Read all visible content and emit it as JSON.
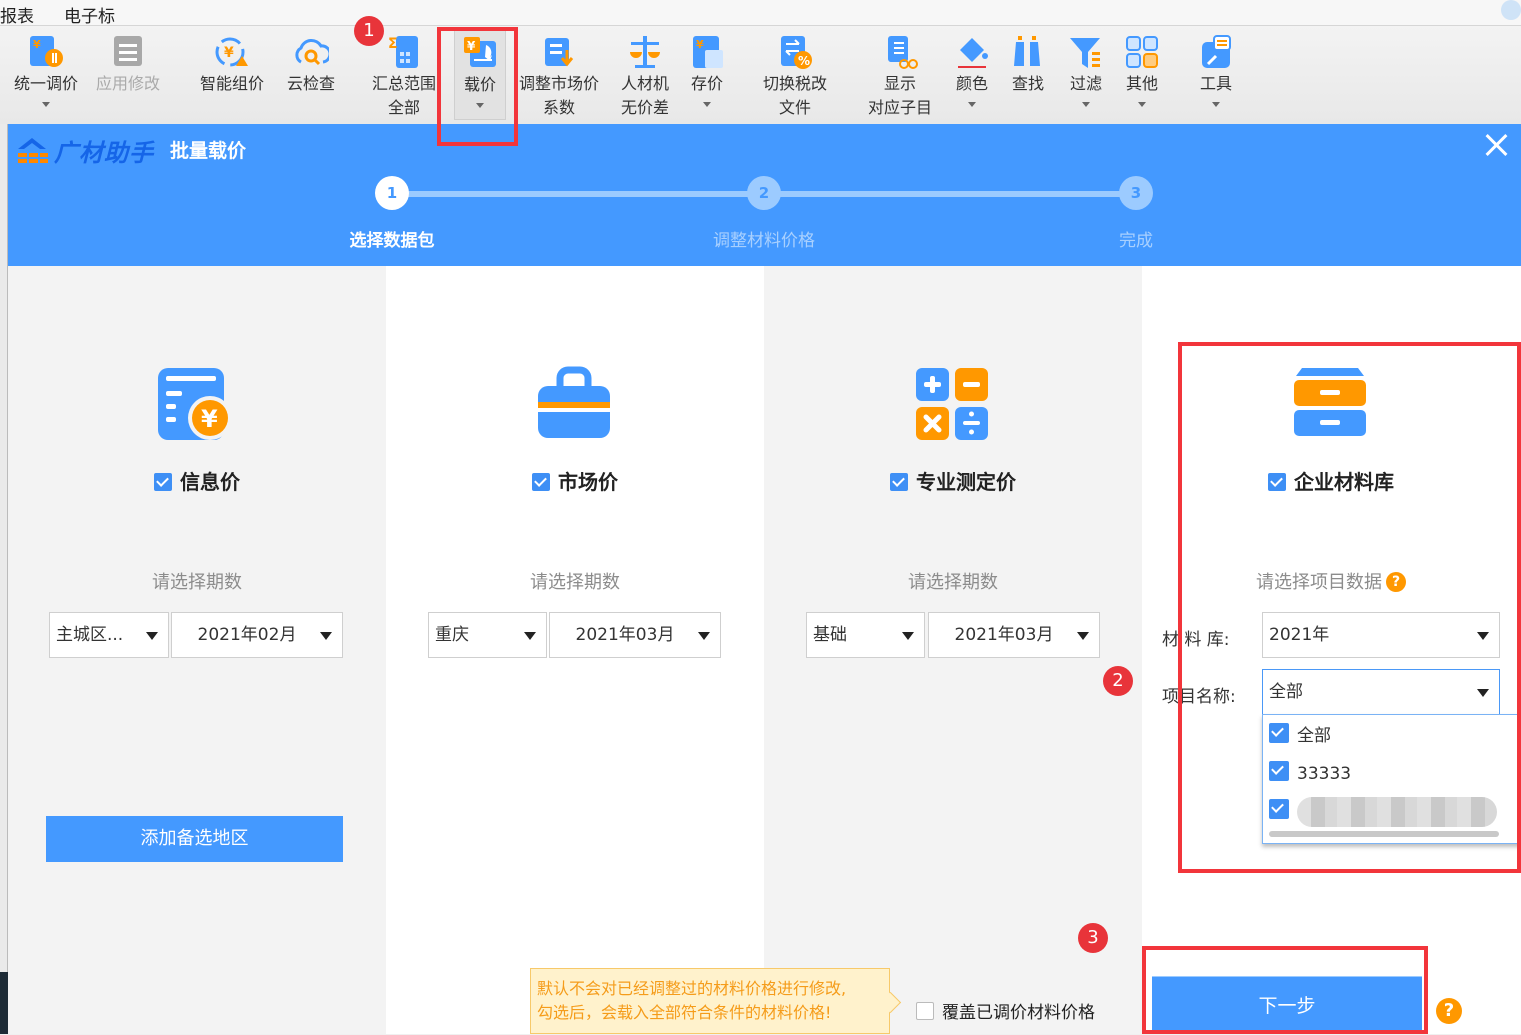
{
  "menubar": {
    "items": [
      "报表",
      "电子标"
    ]
  },
  "ribbon": {
    "buttons": [
      {
        "label": "统一调价",
        "label2": "",
        "caret": true,
        "disabled": false
      },
      {
        "label": "应用修改",
        "label2": "",
        "caret": false,
        "disabled": true
      },
      {
        "label": "智能组价",
        "label2": "",
        "caret": false,
        "disabled": false
      },
      {
        "label": "云检查",
        "label2": "",
        "caret": false,
        "disabled": false
      },
      {
        "label": "汇总范围",
        "label2": "全部",
        "caret": false,
        "disabled": false
      },
      {
        "label": "载价",
        "label2": "",
        "caret": true,
        "disabled": false,
        "active": true
      },
      {
        "label": "调整市场价",
        "label2": "系数",
        "caret": false,
        "disabled": false
      },
      {
        "label": "人材机",
        "label2": "无价差",
        "caret": false,
        "disabled": false
      },
      {
        "label": "存价",
        "label2": "",
        "caret": true,
        "disabled": false
      },
      {
        "label": "切换税改",
        "label2": "文件",
        "caret": false,
        "disabled": false
      },
      {
        "label": "显示",
        "label2": "对应子目",
        "caret": false,
        "disabled": false
      },
      {
        "label": "颜色",
        "label2": "",
        "caret": true,
        "disabled": false
      },
      {
        "label": "查找",
        "label2": "",
        "caret": false,
        "disabled": false
      },
      {
        "label": "过滤",
        "label2": "",
        "caret": true,
        "disabled": false
      },
      {
        "label": "其他",
        "label2": "",
        "caret": true,
        "disabled": false
      },
      {
        "label": "工具",
        "label2": "",
        "caret": true,
        "disabled": false
      }
    ]
  },
  "annotations": {
    "badge1": "1",
    "badge2": "2",
    "badge3": "3"
  },
  "dialog": {
    "brand": "广材助手",
    "title": "批量载价",
    "steps": [
      {
        "num": "1",
        "label": "选择数据包",
        "active": true
      },
      {
        "num": "2",
        "label": "调整材料价格",
        "active": false
      },
      {
        "num": "3",
        "label": "完成",
        "active": false
      }
    ],
    "panels": [
      {
        "title": "信息价",
        "checked": true,
        "subtitle": "请选择期数",
        "region": "主城区...",
        "period": "2021年02月",
        "add_button": "添加备选地区"
      },
      {
        "title": "市场价",
        "checked": true,
        "subtitle": "请选择期数",
        "region": "重庆",
        "period": "2021年03月"
      },
      {
        "title": "专业测定价",
        "checked": true,
        "subtitle": "请选择期数",
        "region": "基础",
        "period": "2021年03月"
      },
      {
        "title": "企业材料库",
        "checked": true,
        "subtitle": "请选择项目数据",
        "help": "?",
        "library_label": "材 料 库:",
        "library_value": "2021年",
        "project_label": "项目名称:",
        "project_value": "全部",
        "project_options": [
          {
            "label": "全部",
            "checked": true
          },
          {
            "label": "33333",
            "checked": true
          },
          {
            "label": "",
            "checked": true,
            "redacted": true
          }
        ]
      }
    ],
    "footer": {
      "tip_line1": "默认不会对已经调整过的材料价格进行修改,",
      "tip_line2": "勾选后，会载入全部符合条件的材料价格!",
      "overwrite_label": "覆盖已调价材料价格",
      "overwrite_checked": false,
      "next_button": "下一步",
      "help": "?"
    }
  },
  "colors": {
    "primary": "#4499ff",
    "accent": "#ff9800",
    "annotation_red": "#f2353b"
  }
}
